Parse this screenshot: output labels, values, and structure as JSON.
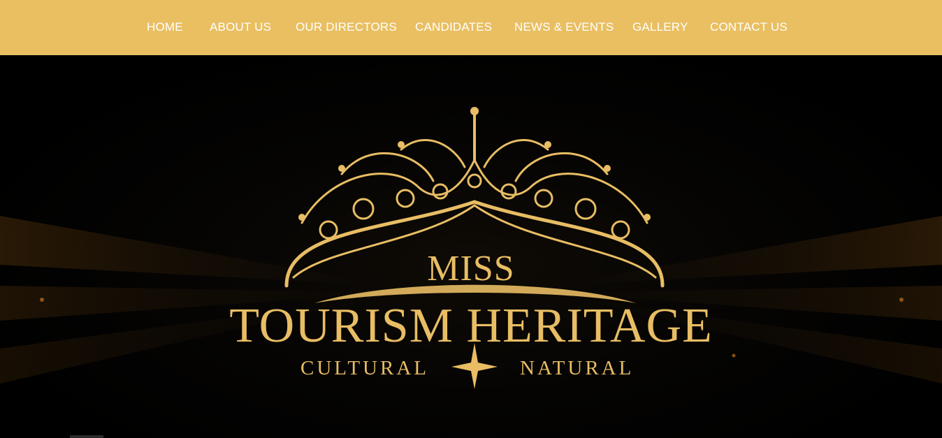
{
  "nav": {
    "items": [
      {
        "label": "HOME"
      },
      {
        "label": "ABOUT US"
      },
      {
        "label": "OUR DIRECTORS"
      },
      {
        "label": "CANDIDATES"
      },
      {
        "label": "NEWS & EVENTS"
      },
      {
        "label": "GALLERY"
      },
      {
        "label": "CONTACT US"
      }
    ],
    "background_color": "#e9bf62",
    "text_color": "#ffffff"
  },
  "hero": {
    "logo": {
      "line1": "MISS",
      "line2": "TOURISM HERITAGE",
      "sub_left": "CULTURAL",
      "sub_right": "NATURAL",
      "emblem": "crown-icon",
      "separator": "star-icon",
      "color": "#e8bd64"
    }
  }
}
